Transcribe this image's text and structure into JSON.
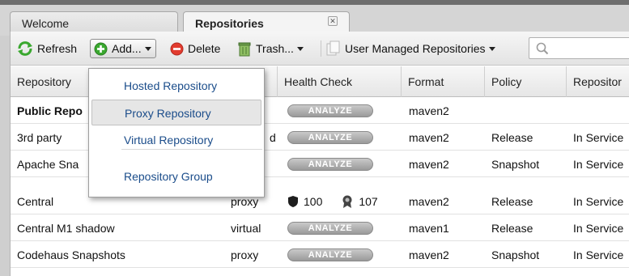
{
  "tabs": [
    {
      "label": "Welcome"
    },
    {
      "label": "Repositories"
    }
  ],
  "toolbar": {
    "refresh_label": "Refresh",
    "add_label": "Add...",
    "delete_label": "Delete",
    "trash_label": "Trash...",
    "user_managed_label": "User Managed Repositories",
    "search_value": ""
  },
  "columns": [
    "Repository",
    "Health Check",
    "Format",
    "Policy",
    "Repositor"
  ],
  "add_menu": {
    "items": [
      {
        "label": "Hosted Repository"
      },
      {
        "label": "Proxy Repository"
      },
      {
        "label": "Virtual Repository"
      },
      {
        "label": "Repository Group"
      }
    ]
  },
  "rows": [
    {
      "name": "Public Repo",
      "type": "",
      "health": "ANALYZE",
      "format": "maven2",
      "policy": "",
      "status": ""
    },
    {
      "name": "3rd party",
      "type": "d",
      "health": "ANALYZE",
      "format": "maven2",
      "policy": "Release",
      "status": "In Service"
    },
    {
      "name": "Apache Sna",
      "type": "",
      "health": "ANALYZE",
      "format": "maven2",
      "policy": "Snapshot",
      "status": "In Service"
    },
    {
      "name": "Central",
      "type": "proxy",
      "health_a": "100",
      "health_b": "107",
      "format": "maven2",
      "policy": "Release",
      "status": "In Service"
    },
    {
      "name": "Central M1 shadow",
      "type": "virtual",
      "health": "ANALYZE",
      "format": "maven1",
      "policy": "Release",
      "status": "In Service"
    },
    {
      "name": "Codehaus Snapshots",
      "type": "proxy",
      "health": "ANALYZE",
      "format": "maven2",
      "policy": "Snapshot",
      "status": "In Service"
    }
  ],
  "colors": {
    "menu_text": "#1a4c8a",
    "add_icon": "#3aa82f",
    "delete_icon": "#e23b2e"
  }
}
